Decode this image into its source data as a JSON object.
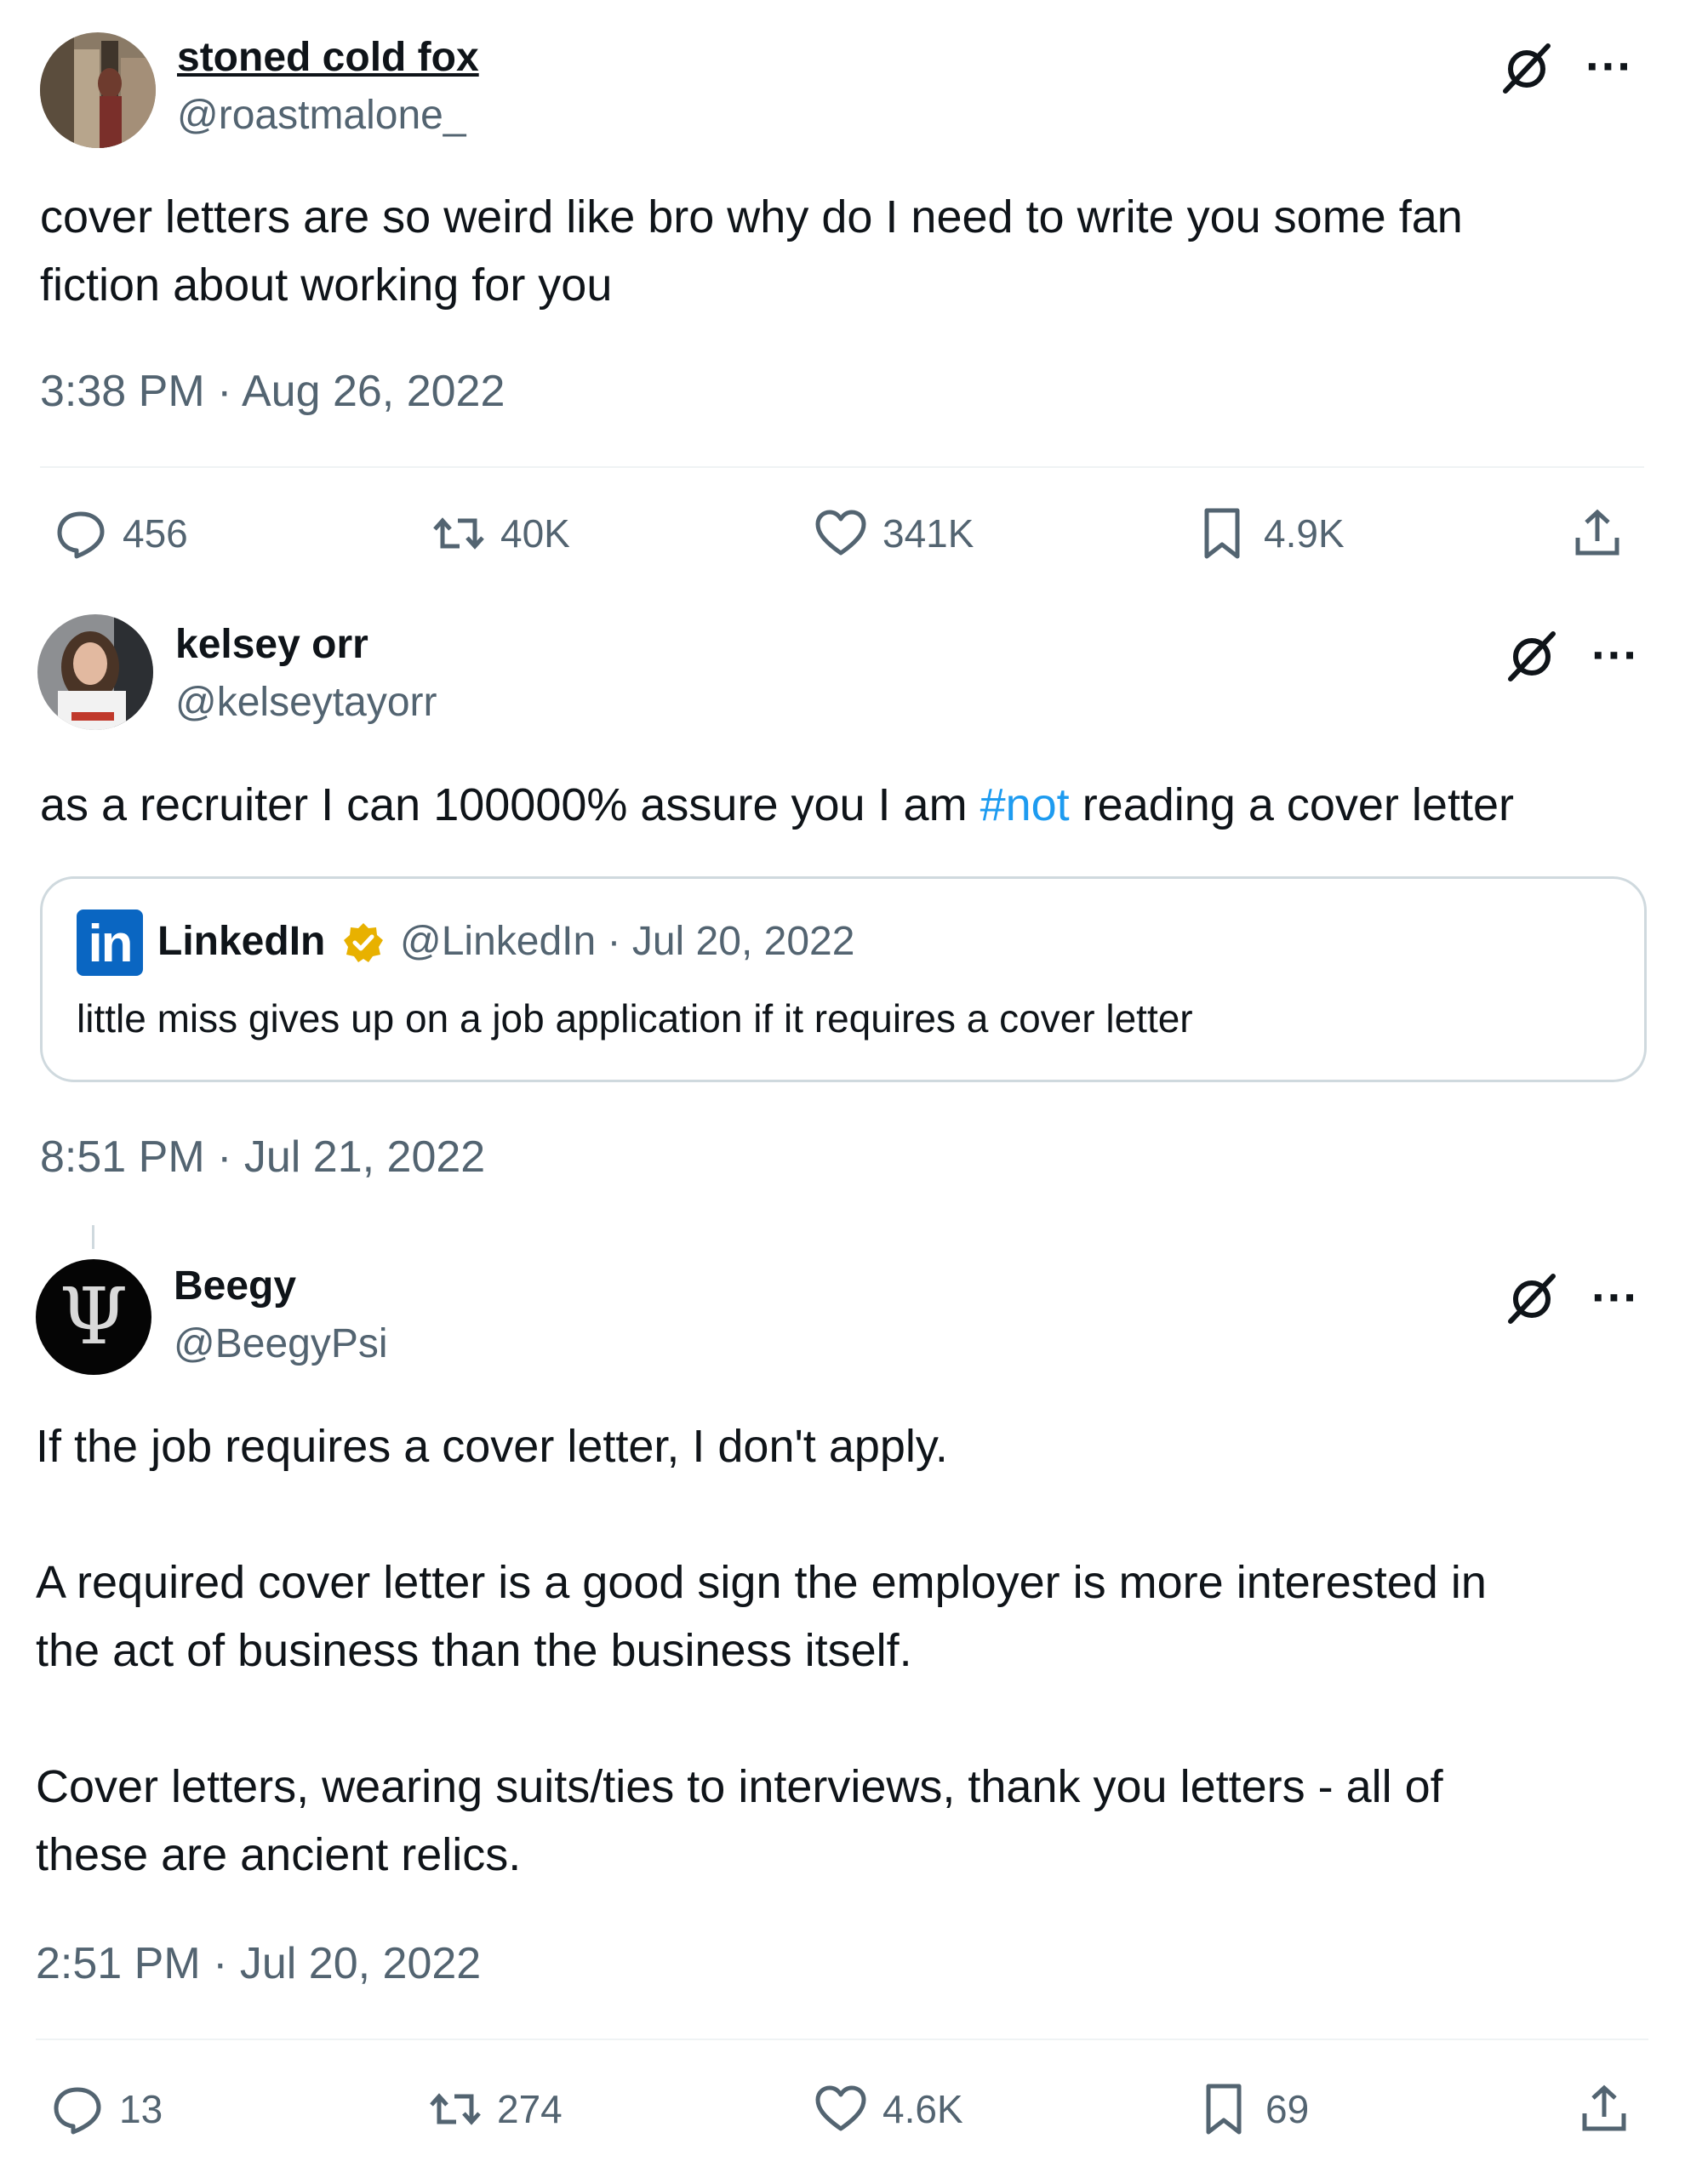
{
  "tweets": [
    {
      "name": "stoned cold fox",
      "handle": "@roastmalone_",
      "text": [
        "cover letters are so weird like bro why do I need to write you some fan",
        "fiction about working for you"
      ],
      "timestamp": "3:38 PM · Aug 26, 2022",
      "stats": {
        "replies": "456",
        "retweets": "40K",
        "likes": "341K",
        "bookmarks": "4.9K"
      }
    },
    {
      "name": "kelsey orr",
      "handle": "@kelseytayorr",
      "text_before": "as a recruiter I can 100000% assure you I am ",
      "hashtag": "#not",
      "text_after": " reading a cover letter",
      "timestamp": "8:51 PM · Jul 21, 2022",
      "quote": {
        "logo": "in",
        "name": "LinkedIn",
        "meta": "@LinkedIn · Jul 20, 2022",
        "text": "little miss gives up on a job application if it requires a cover letter"
      }
    },
    {
      "name": "Beegy",
      "handle": "@BeegyPsi",
      "avatar_glyph": "Ψ",
      "paragraphs": [
        [
          "If the job requires a cover letter, I don't apply."
        ],
        [
          "A required cover letter is a good sign the employer is more interested in",
          "the act of business than the business itself."
        ],
        [
          "Cover letters, wearing suits/ties to interviews, thank you letters - all of",
          "these are ancient relics."
        ]
      ],
      "timestamp": "2:51 PM · Jul 20, 2022",
      "stats": {
        "replies": "13",
        "retweets": "274",
        "likes": "4.6K",
        "bookmarks": "69"
      }
    }
  ],
  "icons": {
    "grok": "slashed-circle-icon",
    "more": "ellipsis-icon",
    "reply": "speech-bubble-icon",
    "retweet": "retweet-arrows-icon",
    "like": "heart-icon",
    "bookmark": "bookmark-icon",
    "share": "share-upload-icon",
    "verified": "gold-verified-badge-icon"
  },
  "colors": {
    "text": "#0f1419",
    "secondary": "#536471",
    "link": "#1d9bf0",
    "linkedin": "#0a66c2",
    "verified_gold": "#e8b100"
  },
  "more_glyph": "···"
}
